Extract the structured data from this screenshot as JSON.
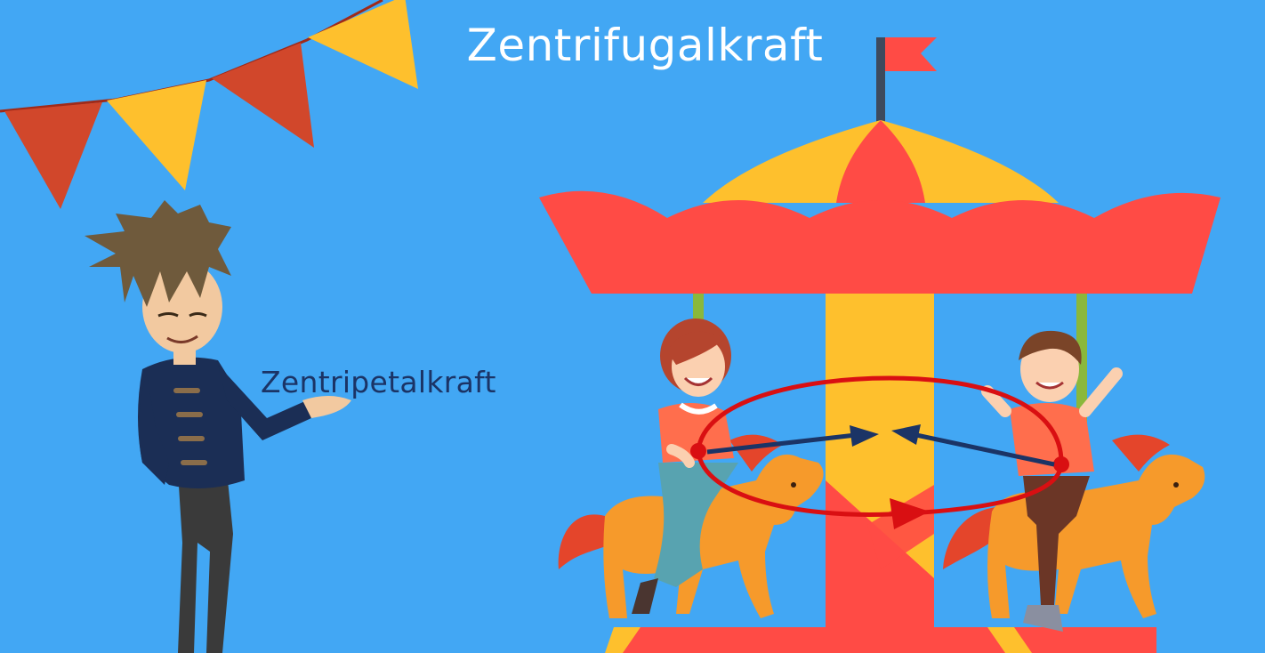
{
  "title": "Zentrifugalkraft",
  "label_centripetal": "Zentripetalkraft",
  "colors": {
    "background": "#42a7f4",
    "red": "#ff4b45",
    "yellow": "#fec02d",
    "dark_red": "#d1472b",
    "navy": "#1b3466",
    "arrow_red": "#d90f12",
    "horse_orange": "#f69a2b"
  }
}
